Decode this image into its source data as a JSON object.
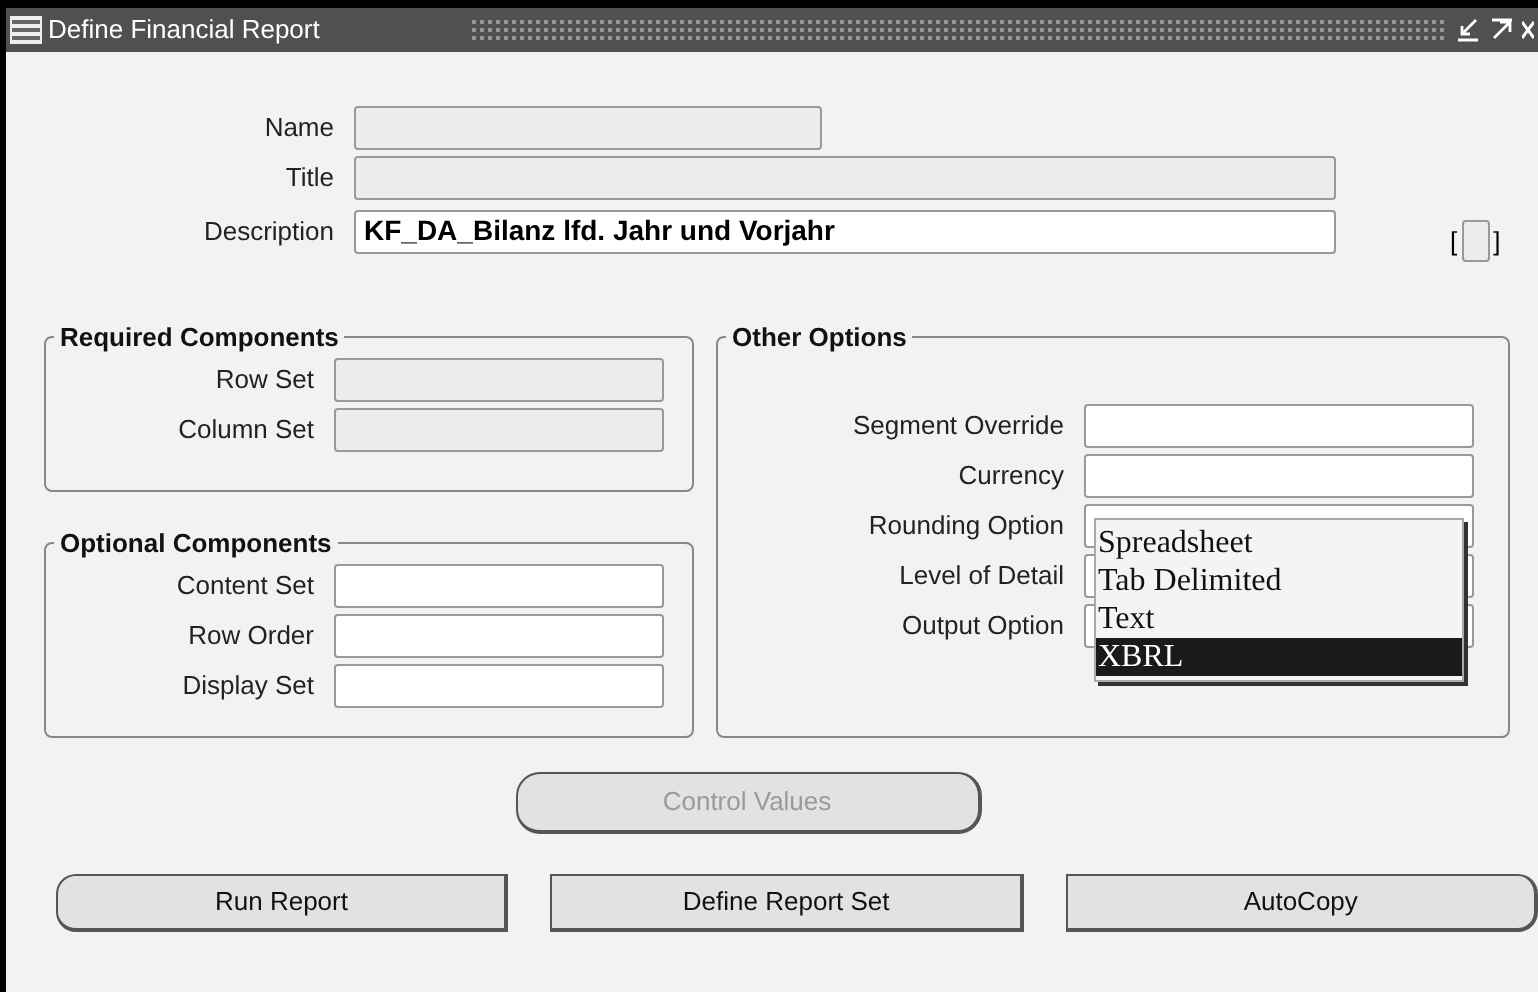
{
  "window": {
    "title": "Define Financial Report"
  },
  "header_fields": [
    {
      "label": "Name",
      "kind": "text",
      "disabled": true,
      "wide": false
    },
    {
      "label": "Title",
      "kind": "text",
      "disabled": true,
      "wide": true
    },
    {
      "label": "Description",
      "kind": "text",
      "disabled": false,
      "wide": true,
      "value": "KF_DA_Bilanz lfd. Jahr und Vorjahr"
    }
  ],
  "flex_field": {
    "open": "[",
    "close": "]"
  },
  "required_components": {
    "title": "Required Components",
    "fields": [
      {
        "label": "Row Set",
        "kind": "text",
        "disabled": true
      },
      {
        "label": "Column Set",
        "kind": "text",
        "disabled": true
      }
    ]
  },
  "optional_components": {
    "title": "Optional Components",
    "fields": [
      {
        "label": "Content Set",
        "kind": "text",
        "disabled": false
      },
      {
        "label": "Row Order",
        "kind": "text",
        "disabled": false
      },
      {
        "label": "Display Set",
        "kind": "text",
        "disabled": false
      }
    ]
  },
  "other_options": {
    "title": "Other Options",
    "fields": [
      {
        "label": "Segment Override",
        "kind": "text",
        "disabled": false
      },
      {
        "label": "Currency",
        "kind": "text",
        "disabled": false
      },
      {
        "label": "Rounding Option",
        "kind": "select",
        "disabled": false
      },
      {
        "label": "Level of Detail",
        "kind": "select",
        "disabled": false
      },
      {
        "label": "Output Option",
        "kind": "select",
        "disabled": false
      }
    ]
  },
  "output_option_list": [
    {
      "label": "Spreadsheet",
      "selected": false
    },
    {
      "label": "Tab Delimited",
      "selected": false
    },
    {
      "label": "Text",
      "selected": false
    },
    {
      "label": "XBRL",
      "selected": true
    }
  ],
  "control_values_button": {
    "label": "Control Values",
    "disabled": true
  },
  "buttons": [
    {
      "label": "Run Report",
      "disabled": false
    },
    {
      "label": "Define Report Set",
      "disabled": false
    },
    {
      "label": "AutoCopy",
      "disabled": false
    }
  ]
}
